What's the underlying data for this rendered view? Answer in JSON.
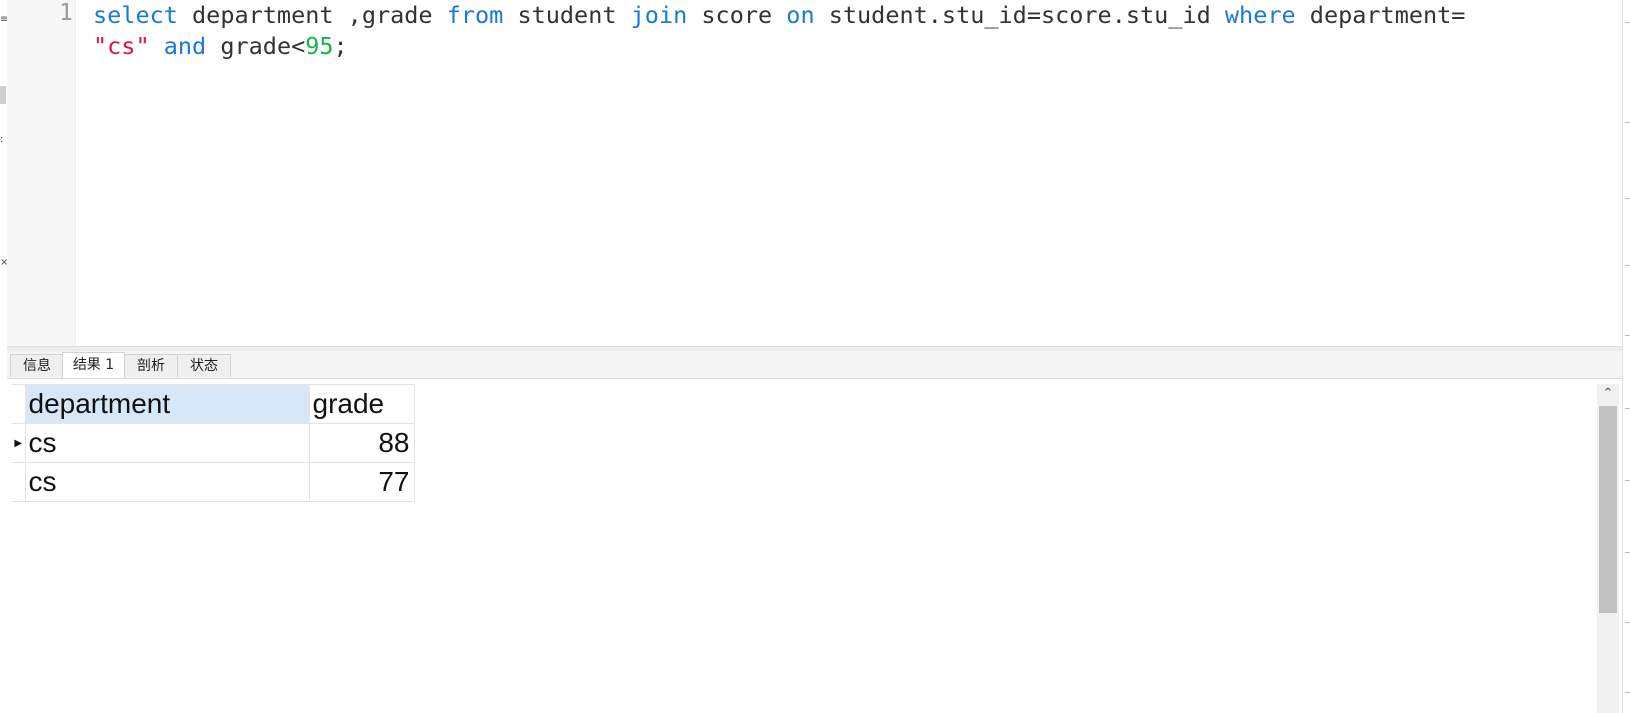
{
  "editor": {
    "line_number": "1",
    "tokens": [
      {
        "t": "select",
        "c": "kw"
      },
      {
        "t": " department ,grade ",
        "c": "plain"
      },
      {
        "t": "from",
        "c": "kw"
      },
      {
        "t": " student ",
        "c": "plain"
      },
      {
        "t": "join",
        "c": "kw"
      },
      {
        "t": " score ",
        "c": "plain"
      },
      {
        "t": "on",
        "c": "kw"
      },
      {
        "t": " student.stu_id=score.stu_id ",
        "c": "plain"
      },
      {
        "t": "where",
        "c": "kw"
      },
      {
        "t": " department=",
        "c": "plain"
      },
      {
        "t": "\n",
        "c": "plain"
      },
      {
        "t": "\"cs\"",
        "c": "str"
      },
      {
        "t": " ",
        "c": "plain"
      },
      {
        "t": "and",
        "c": "kw"
      },
      {
        "t": " grade<",
        "c": "plain"
      },
      {
        "t": "95",
        "c": "num"
      },
      {
        "t": ";",
        "c": "plain"
      }
    ]
  },
  "tabs": [
    {
      "label": "信息",
      "active": false
    },
    {
      "label": "结果 1",
      "active": true
    },
    {
      "label": "剖析",
      "active": false
    },
    {
      "label": "状态",
      "active": false
    }
  ],
  "results": {
    "columns": [
      "department",
      "grade"
    ],
    "rows": [
      {
        "department": "cs",
        "grade": "88",
        "current": true
      },
      {
        "department": "cs",
        "grade": "77",
        "current": false
      }
    ]
  },
  "colors": {
    "keyword": "#1a78d8",
    "string": "#e0143c",
    "number": "#19b54a",
    "selected_header": "#d6e8f8"
  }
}
